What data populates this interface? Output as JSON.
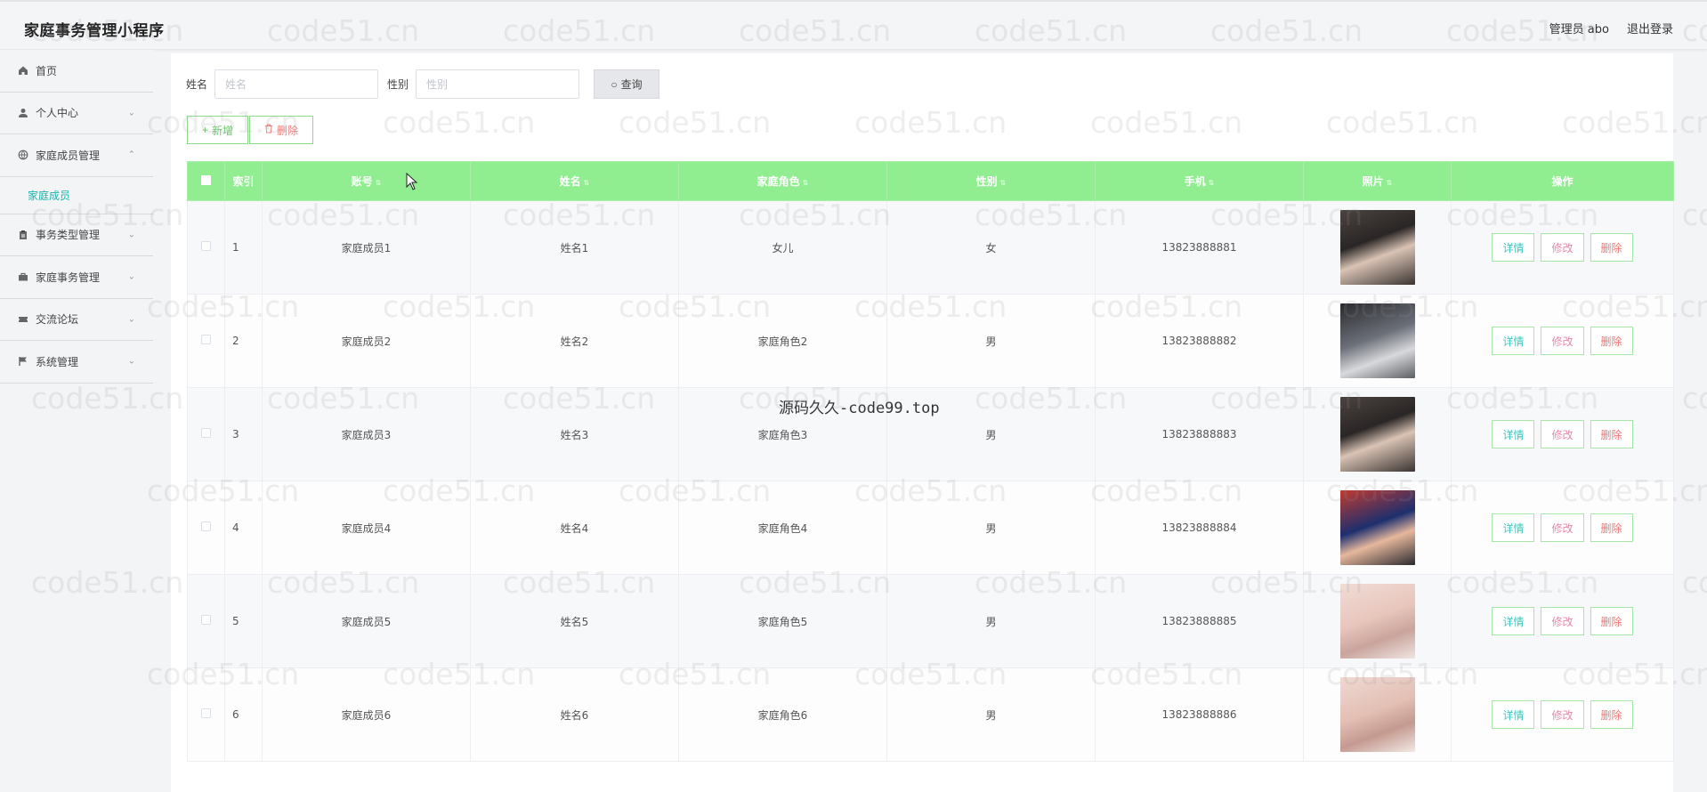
{
  "app_title": "家庭事务管理小程序",
  "header": {
    "admin": "管理员 abo",
    "logout": "退出登录"
  },
  "sidebar": {
    "items": [
      {
        "label": "首页",
        "icon": "home-icon"
      },
      {
        "label": "个人中心",
        "icon": "user-icon"
      },
      {
        "label": "家庭成员管理",
        "icon": "globe-icon",
        "expanded": true,
        "submenu": [
          "家庭成员"
        ]
      },
      {
        "label": "事务类型管理",
        "icon": "clipboard-icon"
      },
      {
        "label": "家庭事务管理",
        "icon": "briefcase-icon"
      },
      {
        "label": "交流论坛",
        "icon": "ticket-icon"
      },
      {
        "label": "系统管理",
        "icon": "flag-icon"
      }
    ]
  },
  "search": {
    "name_label": "姓名",
    "name_placeholder": "姓名",
    "gender_label": "性别",
    "gender_placeholder": "性别",
    "query_label": "查询"
  },
  "actions": {
    "add": "新增",
    "delete": "删除"
  },
  "table": {
    "headers": [
      "索引",
      "账号",
      "姓名",
      "家庭角色",
      "性别",
      "手机",
      "照片",
      "操作"
    ],
    "rows": [
      {
        "idx": "1",
        "account": "家庭成员1",
        "name": "姓名1",
        "role": "女儿",
        "gender": "女",
        "phone": "13823888881"
      },
      {
        "idx": "2",
        "account": "家庭成员2",
        "name": "姓名2",
        "role": "家庭角色2",
        "gender": "男",
        "phone": "13823888882"
      },
      {
        "idx": "3",
        "account": "家庭成员3",
        "name": "姓名3",
        "role": "家庭角色3",
        "gender": "男",
        "phone": "13823888883"
      },
      {
        "idx": "4",
        "account": "家庭成员4",
        "name": "姓名4",
        "role": "家庭角色4",
        "gender": "男",
        "phone": "13823888884"
      },
      {
        "idx": "5",
        "account": "家庭成员5",
        "name": "姓名5",
        "role": "家庭角色5",
        "gender": "男",
        "phone": "13823888885"
      },
      {
        "idx": "6",
        "account": "家庭成员6",
        "name": "姓名6",
        "role": "家庭角色6",
        "gender": "男",
        "phone": "13823888886"
      }
    ],
    "row_actions": {
      "detail": "详情",
      "edit": "修改",
      "delete": "删除"
    }
  },
  "overlay_text": "源码久久-code99.top",
  "watermark_text": "code51.cn",
  "colors": {
    "header_green": "#90ee90",
    "accent_teal": "#1fb5ac",
    "delete_red": "#f07474"
  }
}
